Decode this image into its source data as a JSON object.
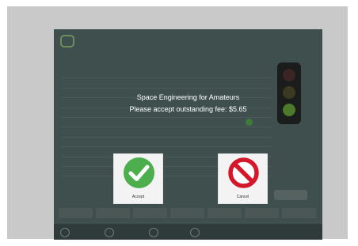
{
  "dialog": {
    "title": "Space Engineering for Amateurs",
    "message": "Please accept outstanding fee: $5.65",
    "accept_label": "Accept",
    "cancel_label": "Cancel"
  },
  "colors": {
    "accept": "#4cae4c",
    "cancel": "#d4172b",
    "overlay": "#3f4f4e"
  },
  "icons": {
    "accept": "checkmark-circle-icon",
    "cancel": "prohibited-circle-icon"
  }
}
